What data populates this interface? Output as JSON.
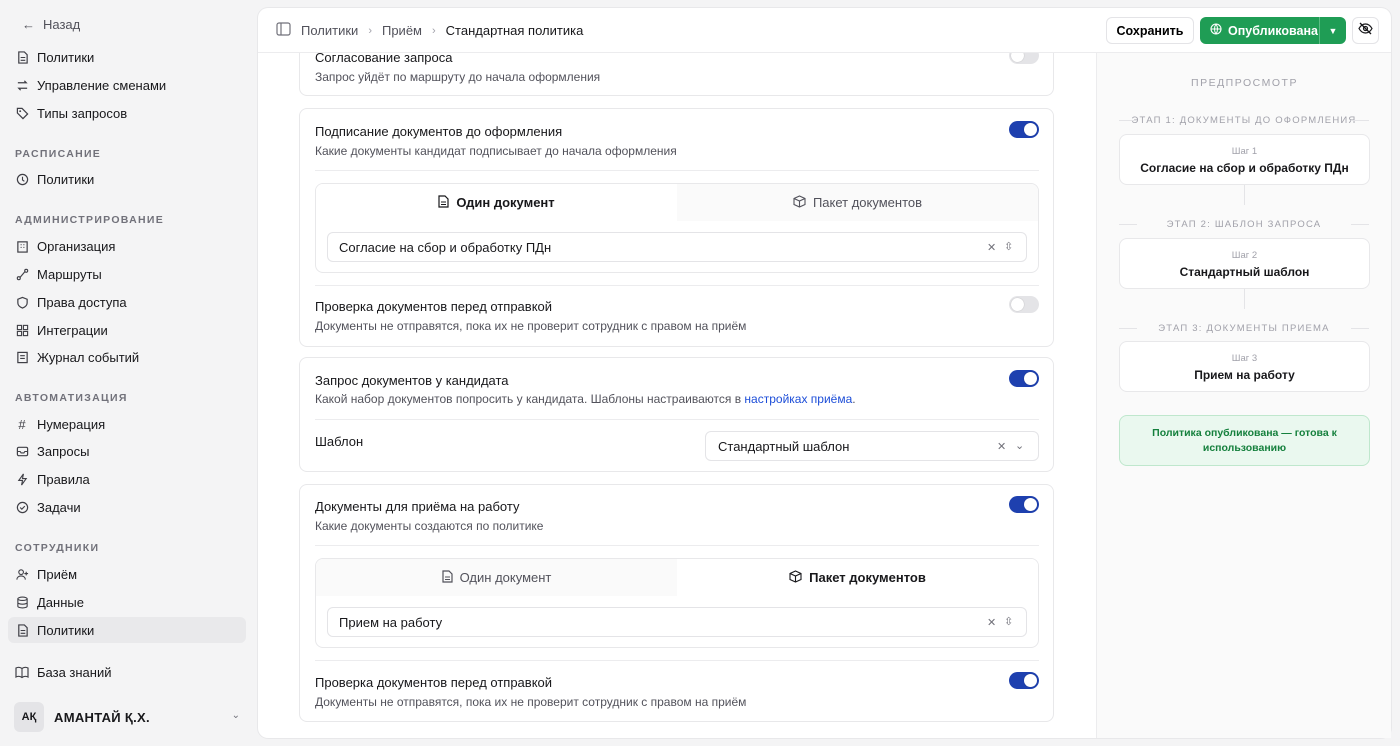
{
  "sidebar": {
    "back": "Назад",
    "top_items": [
      "Политики",
      "Управление сменами",
      "Типы запросов"
    ],
    "section_schedule": "РАСПИСАНИЕ",
    "schedule_items": [
      "Политики"
    ],
    "section_admin": "АДМИНИСТРИРОВАНИЕ",
    "admin_items": [
      "Организация",
      "Маршруты",
      "Права доступа",
      "Интеграции",
      "Журнал событий"
    ],
    "section_auto": "АВТОМАТИЗАЦИЯ",
    "auto_items": [
      "Нумерация",
      "Запросы",
      "Правила",
      "Задачи"
    ],
    "section_staff": "СОТРУДНИКИ",
    "staff_items": [
      "Приём",
      "Данные",
      "Политики"
    ],
    "knowledge": "База знаний",
    "user_initials": "АҚ",
    "user_name": "АМАНТАЙ Қ.Х."
  },
  "topbar": {
    "crumbs": [
      "Политики",
      "Приём",
      "Стандартная политика"
    ],
    "save": "Сохранить",
    "publish": "Опубликована"
  },
  "settings": {
    "approval": {
      "title": "Согласование запроса",
      "desc": "Запрос уйдёт по маршруту до начала оформления",
      "enabled": false
    },
    "sign": {
      "title": "Подписание документов до оформления",
      "desc": "Какие документы кандидат подписывает до начала оформления",
      "enabled": true,
      "tab_single": "Один документ",
      "tab_package": "Пакет документов",
      "selected_tab": "single",
      "value": "Согласие на сбор и обработку ПДн"
    },
    "sign_check": {
      "title": "Проверка документов перед отправкой",
      "desc": "Документы не отправятся, пока их не проверит сотрудник с правом на приём",
      "enabled": false
    },
    "request": {
      "title": "Запрос документов у кандидата",
      "desc": "Какой набор документов попросить у кандидата. Шаблоны настраиваются в ",
      "link": "настройках приёма",
      "desc_end": ".",
      "enabled": true,
      "template_label": "Шаблон",
      "template_value": "Стандартный шаблон"
    },
    "hire_docs": {
      "title": "Документы для приёма на работу",
      "desc": "Какие документы создаются по политике",
      "enabled": true,
      "tab_single": "Один документ",
      "tab_package": "Пакет документов",
      "selected_tab": "package",
      "value": "Прием на работу"
    },
    "hire_check": {
      "title": "Проверка документов перед отправкой",
      "desc": "Документы не отправятся, пока их не проверит сотрудник с правом на приём",
      "enabled": true
    }
  },
  "preview": {
    "title": "ПРЕДПРОСМОТР",
    "stages": [
      {
        "stage": "ЭТАП 1: ДОКУМЕНТЫ ДО ОФОРМЛЕНИЯ",
        "step": "Шаг 1",
        "name": "Согласие на сбор и обработку ПДн"
      },
      {
        "stage": "ЭТАП 2: ШАБЛОН ЗАПРОСА",
        "step": "Шаг 2",
        "name": "Стандартный шаблон"
      },
      {
        "stage": "ЭТАП 3: ДОКУМЕНТЫ ПРИЕМА",
        "step": "Шаг 3",
        "name": "Прием на работу"
      }
    ],
    "note": "Политика опубликована — готова к использованию"
  },
  "colors": {
    "accent": "#1e40af",
    "publish": "#1f9d55",
    "link": "#1d4ed8"
  }
}
